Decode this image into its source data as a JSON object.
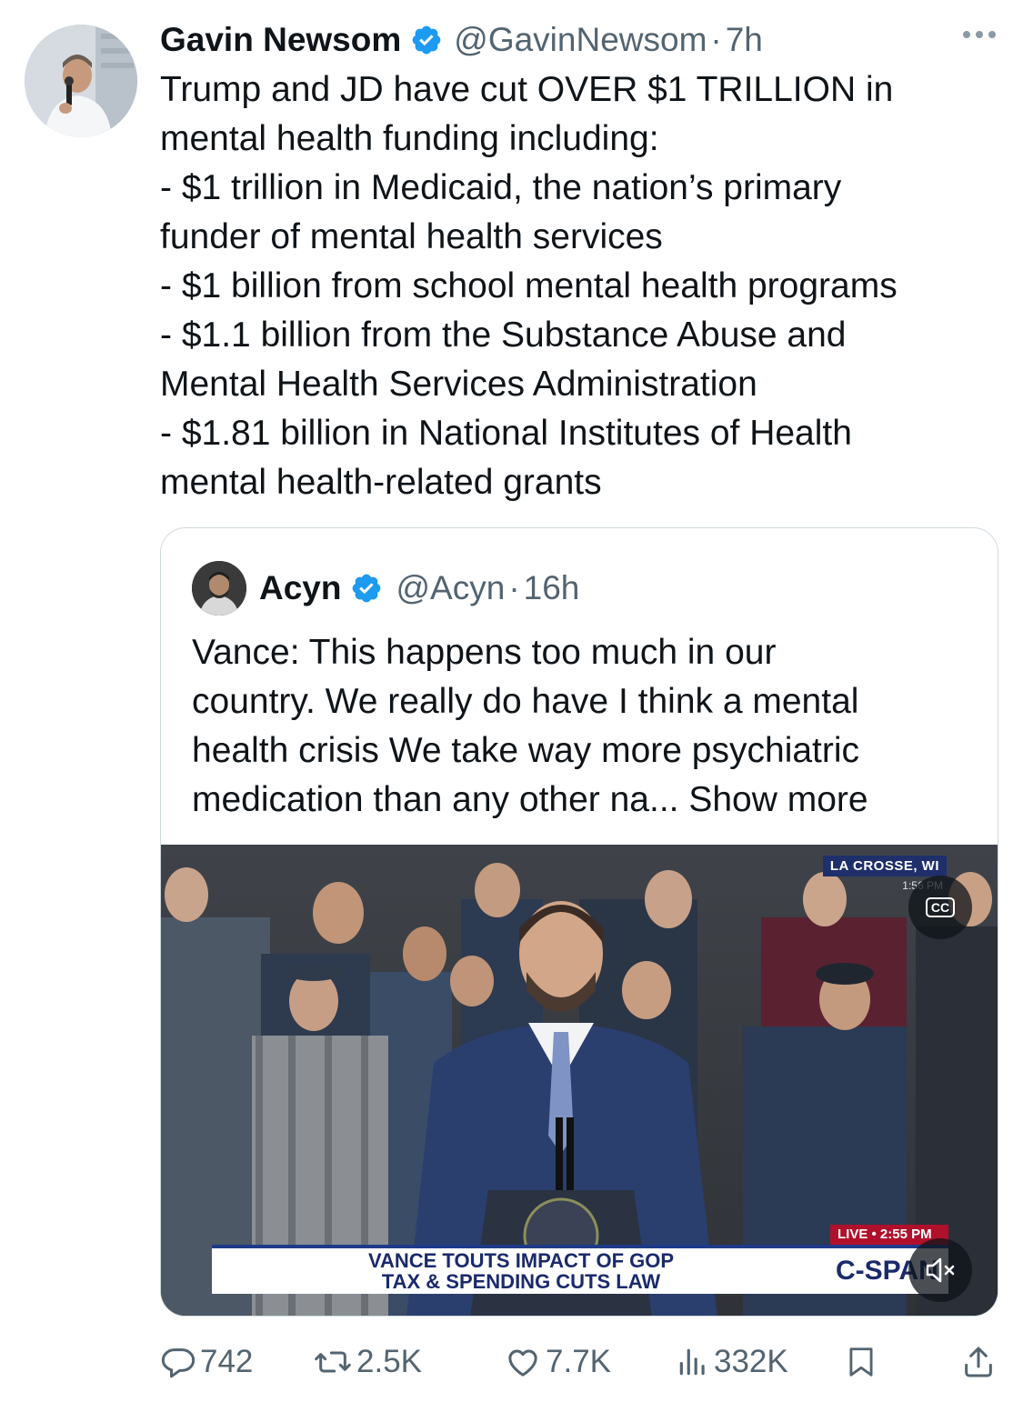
{
  "author": {
    "name": "Gavin Newsom",
    "handle": "@GavinNewsom",
    "separator": "·",
    "time": "7h"
  },
  "body": {
    "lines": [
      "Trump and JD have cut OVER $1 TRILLION in",
      "mental health funding including:",
      "- $1 trillion in Medicaid, the nation’s primary",
      "funder of mental health services",
      "- $1 billion from school mental health programs",
      "- $1.1 billion from the Substance Abuse and",
      "Mental Health Services Administration",
      "- $1.81 billion in National Institutes of Health",
      "mental health-related grants"
    ]
  },
  "quote": {
    "name": "Acyn",
    "handle": "@Acyn",
    "separator": "·",
    "time": "16h",
    "lines": [
      "Vance: This happens too much in our",
      "country. We really do have I think a mental",
      "health crisis We take way more psychiatric",
      "medication than any other na... "
    ],
    "show_more": "Show more",
    "video": {
      "location": "LA CROSSE, WI",
      "location_time": "1:56 PM",
      "cc_label": "CC",
      "headline_line1": "VANCE TOUTS IMPACT OF GOP",
      "headline_line2": "TAX & SPENDING CUTS LAW",
      "live_label": "LIVE • 2:55 PM",
      "network": "C-SPAN"
    }
  },
  "actions": {
    "replies": "742",
    "reposts": "2.5K",
    "likes": "7.7K",
    "views": "332K"
  },
  "colors": {
    "text": "#0f1419",
    "muted": "#536471",
    "verified": "#1d9bf0",
    "border": "#cfd9de"
  }
}
